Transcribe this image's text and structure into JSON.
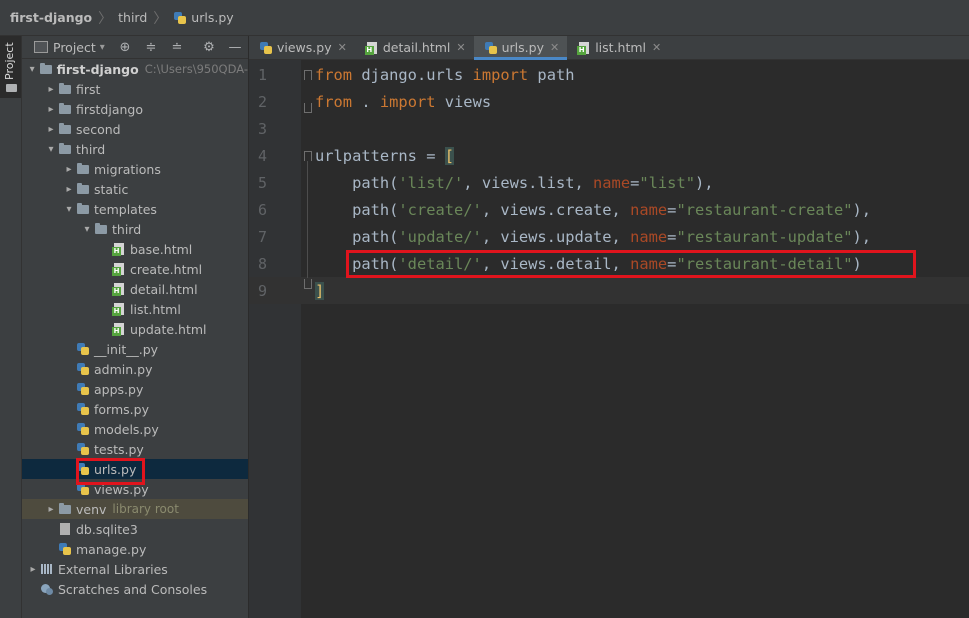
{
  "breadcrumb": [
    "first-django",
    "third",
    "urls.py"
  ],
  "sidebar_tab": "Project",
  "project_panel": {
    "title": "Project",
    "tree": [
      {
        "label": "first-django",
        "hint": "C:\\Users\\950QDA-",
        "type": "folder",
        "depth": 0,
        "expanded": true,
        "bold": true
      },
      {
        "label": "first",
        "type": "folder",
        "depth": 1,
        "expanded": false
      },
      {
        "label": "firstdjango",
        "type": "folder",
        "depth": 1,
        "expanded": false
      },
      {
        "label": "second",
        "type": "folder",
        "depth": 1,
        "expanded": false
      },
      {
        "label": "third",
        "type": "folder",
        "depth": 1,
        "expanded": true
      },
      {
        "label": "migrations",
        "type": "folder",
        "depth": 2,
        "expanded": false
      },
      {
        "label": "static",
        "type": "folder",
        "depth": 2,
        "expanded": false
      },
      {
        "label": "templates",
        "type": "folder",
        "depth": 2,
        "expanded": true
      },
      {
        "label": "third",
        "type": "folder",
        "depth": 3,
        "expanded": true
      },
      {
        "label": "base.html",
        "type": "html",
        "depth": 4
      },
      {
        "label": "create.html",
        "type": "html",
        "depth": 4
      },
      {
        "label": "detail.html",
        "type": "html",
        "depth": 4
      },
      {
        "label": "list.html",
        "type": "html",
        "depth": 4
      },
      {
        "label": "update.html",
        "type": "html",
        "depth": 4
      },
      {
        "label": "__init__.py",
        "type": "py",
        "depth": 2
      },
      {
        "label": "admin.py",
        "type": "py",
        "depth": 2
      },
      {
        "label": "apps.py",
        "type": "py",
        "depth": 2
      },
      {
        "label": "forms.py",
        "type": "py",
        "depth": 2
      },
      {
        "label": "models.py",
        "type": "py",
        "depth": 2
      },
      {
        "label": "tests.py",
        "type": "py",
        "depth": 2
      },
      {
        "label": "urls.py",
        "type": "py",
        "depth": 2,
        "selected": true
      },
      {
        "label": "views.py",
        "type": "py",
        "depth": 2
      },
      {
        "label": "venv",
        "hint": "library root",
        "type": "folder",
        "depth": 1,
        "expanded": false,
        "excluded": true
      },
      {
        "label": "db.sqlite3",
        "type": "db",
        "depth": 1
      },
      {
        "label": "manage.py",
        "type": "py",
        "depth": 1
      },
      {
        "label": "External Libraries",
        "type": "lib",
        "depth": 0,
        "expanded": false
      },
      {
        "label": "Scratches and Consoles",
        "type": "scratch",
        "depth": 0
      }
    ]
  },
  "tabs": [
    {
      "label": "views.py",
      "type": "py",
      "active": false
    },
    {
      "label": "detail.html",
      "type": "html",
      "active": false
    },
    {
      "label": "urls.py",
      "type": "py",
      "active": true
    },
    {
      "label": "list.html",
      "type": "html",
      "active": false
    }
  ],
  "editor": {
    "lines": [
      {
        "num": "1",
        "tokens": [
          [
            "kw",
            "from"
          ],
          [
            "p",
            " django.urls "
          ],
          [
            "kw",
            "import"
          ],
          [
            "p",
            " path"
          ]
        ]
      },
      {
        "num": "2",
        "tokens": [
          [
            "kw",
            "from"
          ],
          [
            "p",
            " . "
          ],
          [
            "kw",
            "import"
          ],
          [
            "p",
            " views"
          ]
        ]
      },
      {
        "num": "3",
        "tokens": []
      },
      {
        "num": "4",
        "tokens": [
          [
            "p",
            "urlpatterns = "
          ],
          [
            "b",
            "["
          ]
        ]
      },
      {
        "num": "5",
        "tokens": [
          [
            "p",
            "    path("
          ],
          [
            "str",
            "'list/'"
          ],
          [
            "p",
            ", views.list, "
          ],
          [
            "param",
            "name"
          ],
          [
            "p",
            "="
          ],
          [
            "str",
            "\"list\""
          ],
          [
            "p",
            "),"
          ]
        ]
      },
      {
        "num": "6",
        "tokens": [
          [
            "p",
            "    path("
          ],
          [
            "str",
            "'create/'"
          ],
          [
            "p",
            ", views.create, "
          ],
          [
            "param",
            "name"
          ],
          [
            "p",
            "="
          ],
          [
            "str",
            "\"restaurant-create\""
          ],
          [
            "p",
            "),"
          ]
        ]
      },
      {
        "num": "7",
        "tokens": [
          [
            "p",
            "    path("
          ],
          [
            "str",
            "'update/'"
          ],
          [
            "p",
            ", views.update, "
          ],
          [
            "param",
            "name"
          ],
          [
            "p",
            "="
          ],
          [
            "str",
            "\"restaurant-update\""
          ],
          [
            "p",
            "),"
          ]
        ]
      },
      {
        "num": "8",
        "tokens": [
          [
            "p",
            "    path("
          ],
          [
            "str",
            "'detail/'"
          ],
          [
            "p",
            ", views.detail, "
          ],
          [
            "param",
            "name"
          ],
          [
            "p",
            "="
          ],
          [
            "str",
            "\"restaurant-detail\""
          ],
          [
            "p",
            ")"
          ]
        ]
      },
      {
        "num": "9",
        "tokens": [
          [
            "b",
            "]"
          ]
        ]
      }
    ],
    "current_line": 9
  },
  "colors": {
    "keyword": "#cc7832",
    "string": "#6a8759",
    "param": "#aa4926",
    "highlight_box": "#e0141d",
    "selection": "#0d293e"
  }
}
